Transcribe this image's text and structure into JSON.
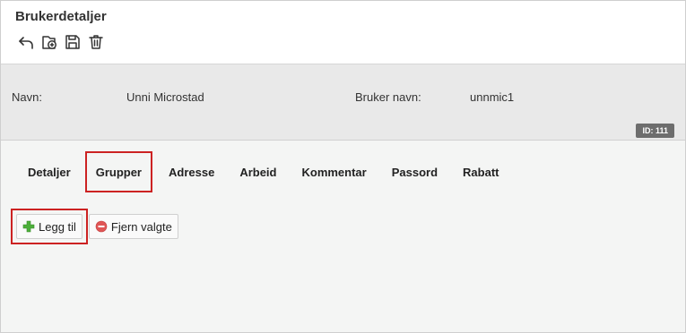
{
  "header": {
    "title": "Brukerdetaljer"
  },
  "toolbar": {
    "icons": [
      "undo-icon",
      "add-document-icon",
      "save-icon",
      "trash-icon"
    ]
  },
  "info": {
    "name_label": "Navn:",
    "name_value": "Unni Microstad",
    "username_label": "Bruker navn:",
    "username_value": "unnmic1",
    "id_badge": "ID: 111"
  },
  "tabs": [
    {
      "label": "Detaljer"
    },
    {
      "label": "Grupper",
      "highlighted": true
    },
    {
      "label": "Adresse"
    },
    {
      "label": "Arbeid"
    },
    {
      "label": "Kommentar"
    },
    {
      "label": "Passord"
    },
    {
      "label": "Rabatt"
    }
  ],
  "actions": {
    "add_label": "Legg til",
    "remove_label": "Fjern valgte"
  },
  "colors": {
    "highlight": "#cc2222",
    "add_icon": "#4caf3a",
    "remove_icon": "#e05555"
  }
}
